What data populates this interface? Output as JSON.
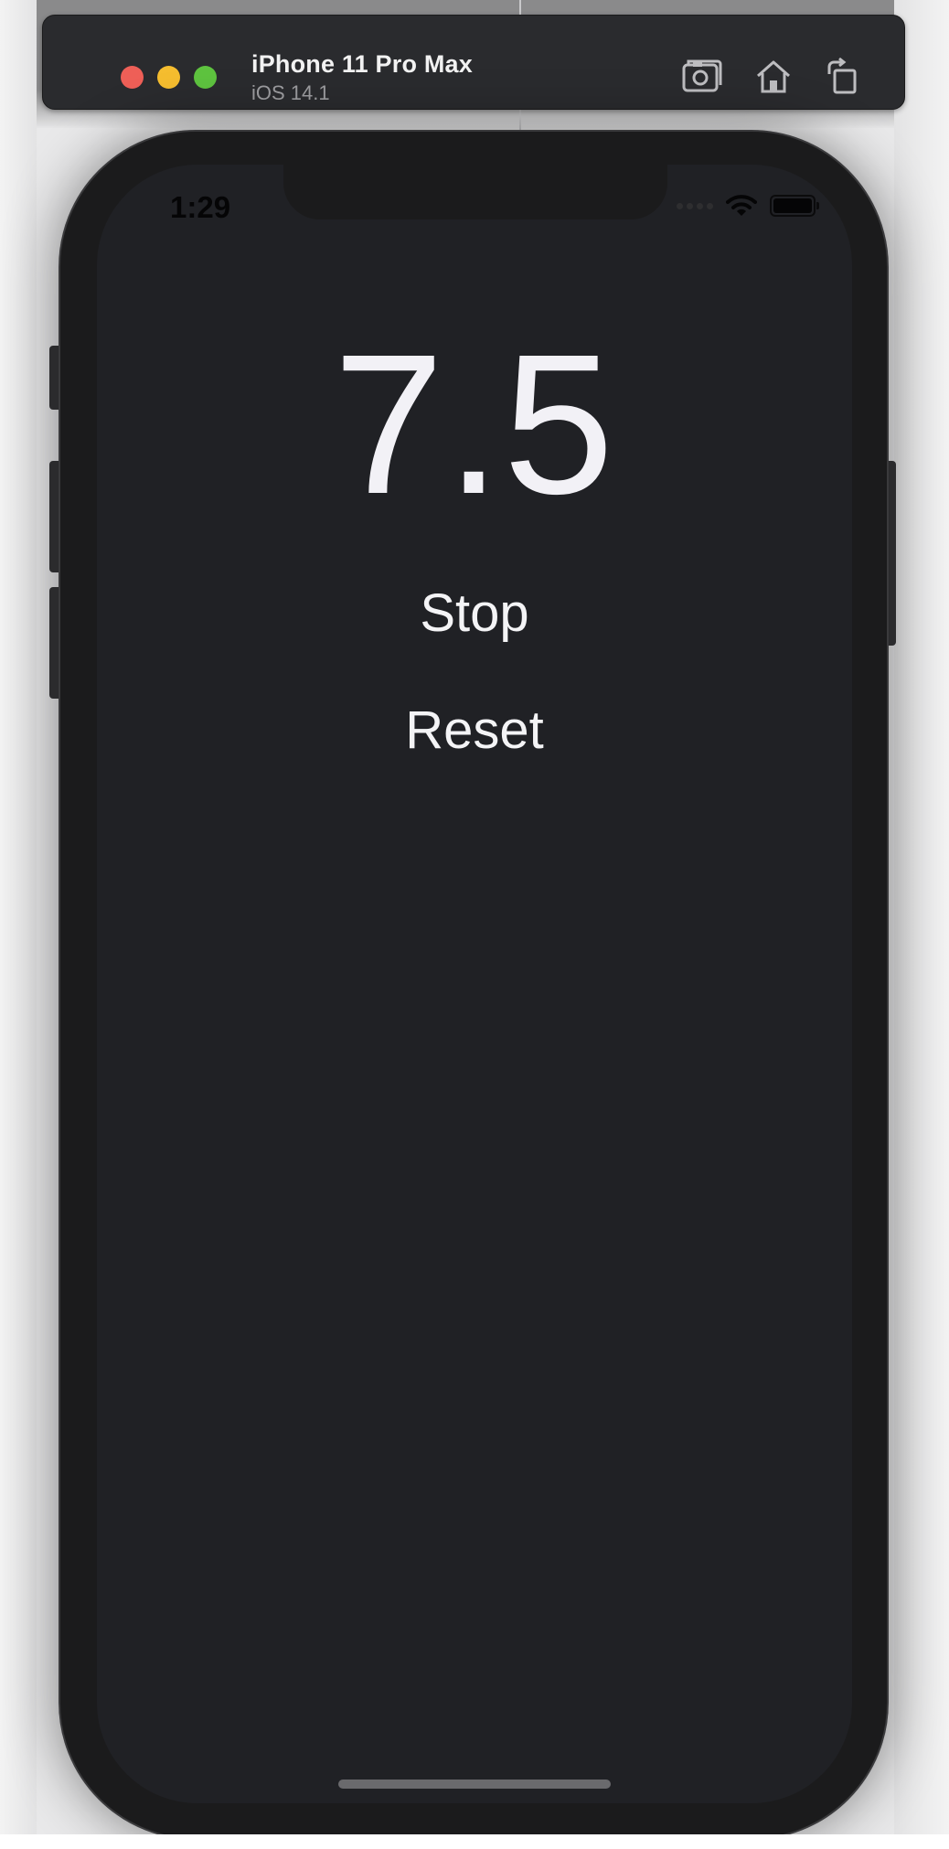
{
  "simulator": {
    "device_name": "iPhone 11 Pro Max",
    "os_version": "iOS 14.1",
    "icons": [
      "screenshot-icon",
      "home-icon",
      "rotate-icon"
    ]
  },
  "status_bar": {
    "time": "1:29"
  },
  "app": {
    "timer_value": "7.5",
    "stop_label": "Stop",
    "reset_label": "Reset"
  },
  "colors": {
    "screen_background": "#202125",
    "text": "#f2f1f6",
    "titlebar": "#2a2b2e"
  }
}
